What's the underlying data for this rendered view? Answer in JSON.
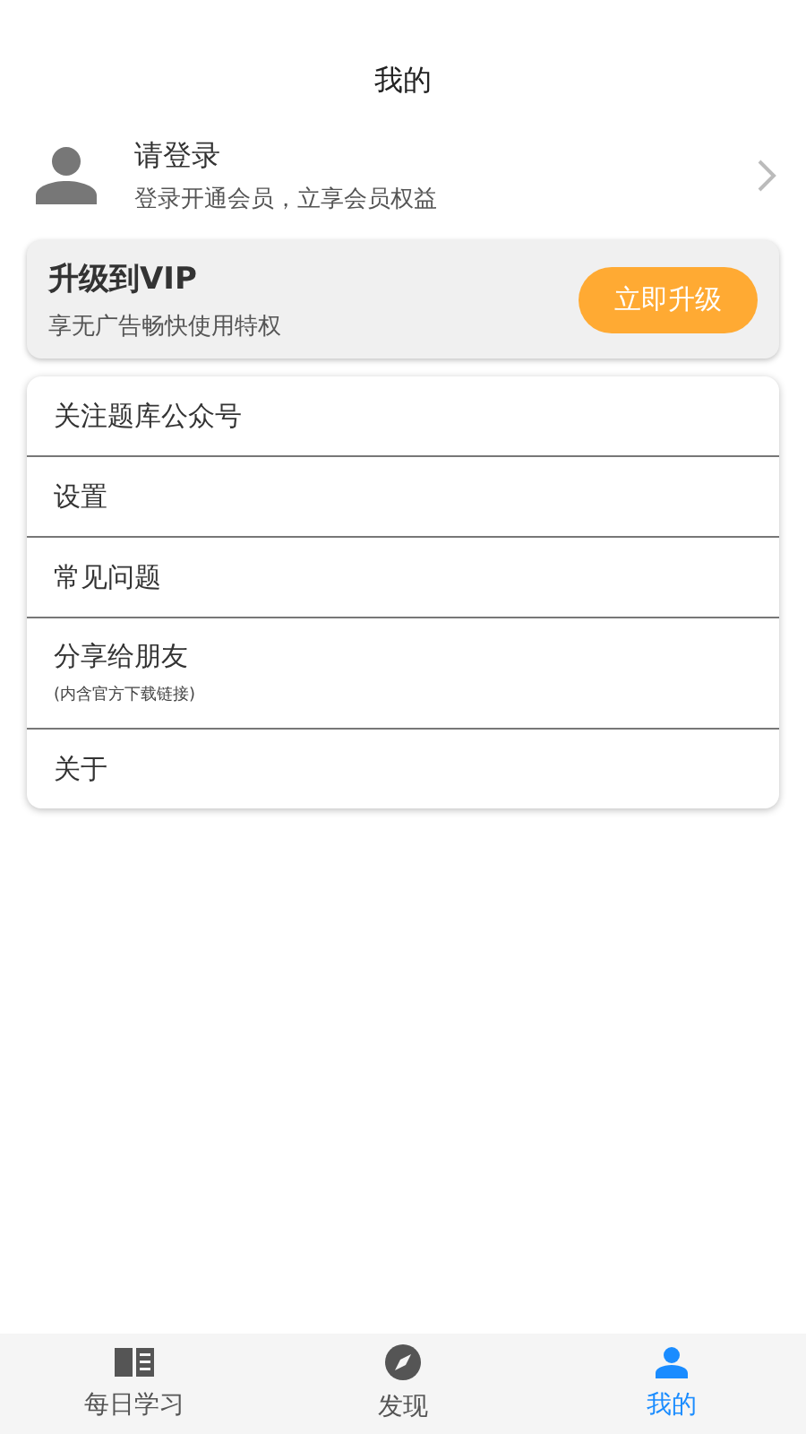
{
  "header": {
    "title": "我的"
  },
  "profile": {
    "name": "请登录",
    "subtitle": "登录开通会员，立享会员权益"
  },
  "vip": {
    "title": "升级到VIP",
    "subtitle": "享无广告畅快使用特权",
    "button": "立即升级"
  },
  "menu": [
    {
      "label": "关注题库公众号"
    },
    {
      "label": "设置"
    },
    {
      "label": "常见问题"
    },
    {
      "label": "分享给朋友",
      "note": "(内含官方下载链接)"
    },
    {
      "label": "关于"
    }
  ],
  "tabs": [
    {
      "label": "每日学习",
      "selected": false
    },
    {
      "label": "发现",
      "selected": false
    },
    {
      "label": "我的",
      "selected": true
    }
  ]
}
